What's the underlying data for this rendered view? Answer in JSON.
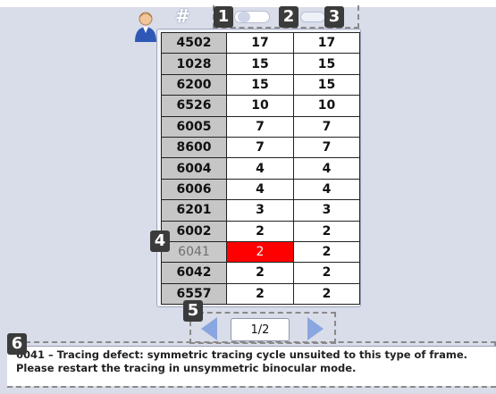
{
  "header": {
    "hash_symbol": "#",
    "avatar_icon": "user-icon",
    "toggle_icon": "toggle-switch-icon"
  },
  "callouts": [
    "1",
    "2",
    "3",
    "4",
    "5",
    "6"
  ],
  "table": {
    "rows": [
      {
        "code": "4502",
        "val1": "17",
        "val2": "17"
      },
      {
        "code": "1028",
        "val1": "15",
        "val2": "15"
      },
      {
        "code": "6200",
        "val1": "15",
        "val2": "15"
      },
      {
        "code": "6526",
        "val1": "10",
        "val2": "10"
      },
      {
        "code": "6005",
        "val1": "7",
        "val2": "7"
      },
      {
        "code": "8600",
        "val1": "7",
        "val2": "7"
      },
      {
        "code": "6004",
        "val1": "4",
        "val2": "4"
      },
      {
        "code": "6006",
        "val1": "4",
        "val2": "4"
      },
      {
        "code": "6201",
        "val1": "3",
        "val2": "3"
      },
      {
        "code": "6002",
        "val1": "2",
        "val2": "2"
      },
      {
        "code": "6041",
        "val1": "2",
        "val2": "2"
      },
      {
        "code": "6042",
        "val1": "2",
        "val2": "2"
      },
      {
        "code": "6557",
        "val1": "2",
        "val2": "2"
      }
    ],
    "selected_code": "6041",
    "selected_color": "#ff0000"
  },
  "pager": {
    "page": "1/2",
    "prev_icon": "arrow-left-icon",
    "next_icon": "arrow-right-icon"
  },
  "message": {
    "text": "6041 – Tracing defect: symmetric tracing cycle unsuited to this type of frame. Please restart the tracing in unsymmetric binocular mode."
  },
  "colors": {
    "background": "#d9dde9",
    "code_cell": "#c6c6c6",
    "badge": "#3b3b3b",
    "arrow": "#8aa6e0"
  }
}
